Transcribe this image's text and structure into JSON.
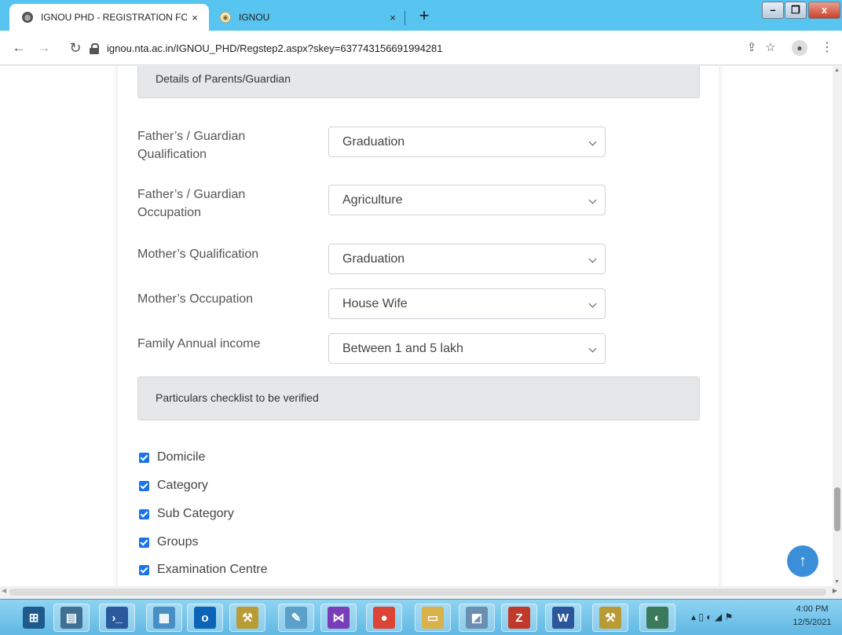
{
  "browser": {
    "tabs": [
      {
        "title": "IGNOU PHD - REGISTRATION FO",
        "close": "×"
      },
      {
        "title": "IGNOU",
        "close": "×"
      }
    ],
    "new_tab": "+",
    "url": "ignou.nta.ac.in/IGNOU_PHD/Regstep2.aspx?skey=637743156691994281",
    "window_buttons": {
      "min": "–",
      "max": "❐",
      "close": "x"
    }
  },
  "form": {
    "section_parents": "Details of Parents/Guardian",
    "fields": [
      {
        "label": "Father’s / Guardian Qualification",
        "value": "Graduation"
      },
      {
        "label": "Father’s / Guardian Occupation",
        "value": "Agriculture"
      },
      {
        "label": "Mother’s Qualification",
        "value": "Graduation"
      },
      {
        "label": "Mother’s Occupation",
        "value": "House Wife"
      },
      {
        "label": "Family Annual income",
        "value": "Between 1 and 5 lakh"
      }
    ],
    "section_checklist": "Particulars checklist to be verified",
    "checklist": [
      {
        "label": "Domicile",
        "checked": true
      },
      {
        "label": "Category",
        "checked": true
      },
      {
        "label": "Sub Category",
        "checked": true
      },
      {
        "label": "Groups",
        "checked": true
      },
      {
        "label": "Examination Centre",
        "checked": true
      }
    ]
  },
  "scroll": {
    "vertical_position": 0.9
  },
  "taskbar": {
    "apps": [
      {
        "name": "start-button",
        "glyph": "⊞",
        "color": "#1e5b8c"
      },
      {
        "name": "server-manager",
        "glyph": "▤",
        "color": "#3f6f93"
      },
      {
        "name": "powershell",
        "glyph": "›_",
        "color": "#2a5a9c"
      },
      {
        "name": "control-panel",
        "glyph": "▦",
        "color": "#4a8fc4"
      },
      {
        "name": "outlook",
        "glyph": "o",
        "color": "#0b64b5"
      },
      {
        "name": "tools",
        "glyph": "⚒",
        "color": "#b99b36"
      },
      {
        "name": "paint",
        "glyph": "✎",
        "color": "#5aa0c8"
      },
      {
        "name": "visual-studio",
        "glyph": "⋈",
        "color": "#7a3db8"
      },
      {
        "name": "chrome",
        "glyph": "●",
        "color": "#db4437"
      },
      {
        "name": "file-explorer",
        "glyph": "▭",
        "color": "#d9b24a"
      },
      {
        "name": "notebook",
        "glyph": "◩",
        "color": "#6a8fb1"
      },
      {
        "name": "filezilla",
        "glyph": "Z",
        "color": "#c0392b"
      },
      {
        "name": "word",
        "glyph": "W",
        "color": "#2b579a"
      },
      {
        "name": "tools-2",
        "glyph": "⚒",
        "color": "#b99b36"
      },
      {
        "name": "network",
        "glyph": "◐",
        "color": "#3a7a5a"
      }
    ],
    "tray_glyphs": "▴ ▯ ◐ ◢ ⚑",
    "time": "4:00 PM",
    "date": "12/5/2021"
  }
}
